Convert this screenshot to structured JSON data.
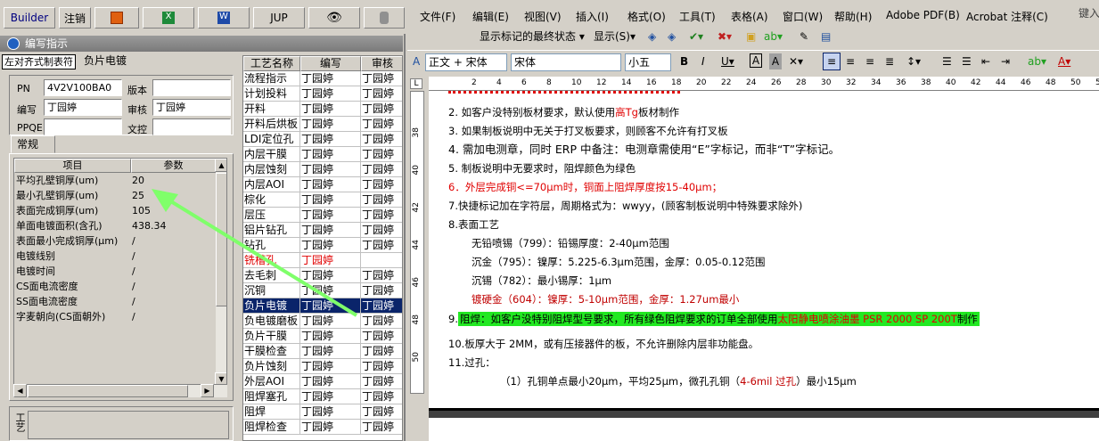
{
  "toolbar": {
    "builder": "Builder",
    "undo": "注销",
    "jup": "JUP"
  },
  "window_title": "编写指示",
  "form_tabs": [
    "左对齐式制表符",
    "负片电镀"
  ],
  "form": {
    "pn_label": "PN",
    "pn_value": "4V2V100BA0",
    "version_label": "版本",
    "version_value": "",
    "author_label": "编写",
    "author_value": "丁园婷",
    "reviewer_label": "审核",
    "reviewer_value": "丁园婷",
    "ppqe_label": "PPQE",
    "ppqe_value": "",
    "doc_label": "文控",
    "doc_value": ""
  },
  "normal_tab": "常规",
  "param_grid": {
    "headers": [
      "项目",
      "参数"
    ],
    "rows": [
      [
        "平均孔壁铜厚(um)",
        "20"
      ],
      [
        "最小孔壁铜厚(um)",
        "25"
      ],
      [
        "表面完成铜厚(um)",
        "105"
      ],
      [
        "单面电镀面积(含孔)",
        "438.34"
      ],
      [
        "表面最小完成铜厚(μm)",
        "/"
      ],
      [
        "电镀线别",
        "/"
      ],
      [
        "电镀时间",
        "/"
      ],
      [
        "CS面电流密度",
        "/"
      ],
      [
        "SS面电流密度",
        "/"
      ],
      [
        "字麦朝向(CS面朝外)",
        "/"
      ]
    ]
  },
  "bottom_label": "工艺",
  "process_list": {
    "headers": [
      "工艺名称",
      "编写",
      "审核"
    ],
    "rows": [
      [
        "流程指示",
        "丁园婷",
        "丁园婷"
      ],
      [
        "计划投料",
        "丁园婷",
        "丁园婷"
      ],
      [
        "开料",
        "丁园婷",
        "丁园婷"
      ],
      [
        "开料后烘板",
        "丁园婷",
        "丁园婷"
      ],
      [
        "LDI定位孔",
        "丁园婷",
        "丁园婷"
      ],
      [
        "内层干膜",
        "丁园婷",
        "丁园婷"
      ],
      [
        "内层蚀刻",
        "丁园婷",
        "丁园婷"
      ],
      [
        "内层AOI",
        "丁园婷",
        "丁园婷"
      ],
      [
        "棕化",
        "丁园婷",
        "丁园婷"
      ],
      [
        "层压",
        "丁园婷",
        "丁园婷"
      ],
      [
        "铝片钻孔",
        "丁园婷",
        "丁园婷"
      ],
      [
        "钻孔",
        "丁园婷",
        "丁园婷"
      ],
      [
        "铣槽孔",
        "丁园婷",
        ""
      ],
      [
        "去毛刺",
        "丁园婷",
        "丁园婷"
      ],
      [
        "沉铜",
        "丁园婷",
        "丁园婷"
      ],
      [
        "负片电镀",
        "丁园婷",
        "丁园婷"
      ],
      [
        "负电镀磨板",
        "丁园婷",
        "丁园婷"
      ],
      [
        "负片干膜",
        "丁园婷",
        "丁园婷"
      ],
      [
        "干膜检查",
        "丁园婷",
        "丁园婷"
      ],
      [
        "负片蚀刻",
        "丁园婷",
        "丁园婷"
      ],
      [
        "外层AOI",
        "丁园婷",
        "丁园婷"
      ],
      [
        "阻焊塞孔",
        "丁园婷",
        "丁园婷"
      ],
      [
        "阻焊",
        "丁园婷",
        "丁园婷"
      ],
      [
        "阻焊检查",
        "丁园婷",
        "丁园婷"
      ]
    ],
    "selected_index": 15,
    "red_index": 12
  },
  "word": {
    "menu": [
      "文件(F)",
      "编辑(E)",
      "视图(V)",
      "插入(I)",
      "格式(O)",
      "工具(T)",
      "表格(A)",
      "窗口(W)",
      "帮助(H)",
      "Adobe PDF(B)",
      "Acrobat 注释(C)"
    ],
    "search_placeholder": "键入问",
    "markup_select": "显示标记的最终状态",
    "show_label": "显示(S)",
    "style_box": "正文 + 宋体",
    "font_box": "宋体",
    "size_box": "小五",
    "ruler_numbers": [
      "2",
      "4",
      "6",
      "8",
      "10",
      "12",
      "14",
      "16",
      "18",
      "20",
      "22",
      "24",
      "26",
      "28",
      "30",
      "32",
      "34",
      "36",
      "38",
      "40",
      "42",
      "44",
      "46",
      "48",
      "50",
      "52"
    ],
    "vruler_numbers": [
      "38",
      "40",
      "42",
      "44",
      "46",
      "48",
      "50"
    ],
    "lines": [
      "2.  如客户没特别板材要求，默认使用",
      "高Tg",
      "板材制作",
      "3.  如果制板说明中无关于打叉板要求，则顾客不允许有打叉板",
      "4.  需加电测章，同时 ERP 中备注：电测章需使用“E”字标记，而非“T”字标记。",
      "5.  制板说明中无要求时，阻焊颜色为绿色",
      "6．外层完成铜<=70μm时，铜面上阻焊厚度按15-40μm；",
      "7.快捷标记加在字符层，周期格式为：wwyy，(顾客制板说明中特殊要求除外)",
      "8.表面工艺",
      "无铅喷锡（799）：铅锡厚度：2-40μm范围",
      "沉金（795）：镍厚：5.225-6.3μm范围，金厚：0.05-0.12范围",
      "沉锡（782）：最小锡厚：1μm",
      "镀硬金（604）：镍厚：5-10μm范围，金厚：1.27um最小",
      "9.",
      "阻焊：如客户没特别阻焊型号要求，所有绿色阻焊要求的订单全部使用",
      "太阳静电喷涂油墨 PSR 2000 SP 200T",
      "制作",
      "10.板厚大于 2MM，或有压接器件的板，不允许删除内层非功能盘。",
      "11.过孔：",
      "（1）孔铜单点最小20μm，平均25μm，微孔孔铜（",
      "4-6mil 过孔",
      "）最小15μm"
    ]
  },
  "colors": {
    "highlight_green": "#22e822",
    "selection_blue": "#0a246a",
    "text_red": "#e00000"
  }
}
